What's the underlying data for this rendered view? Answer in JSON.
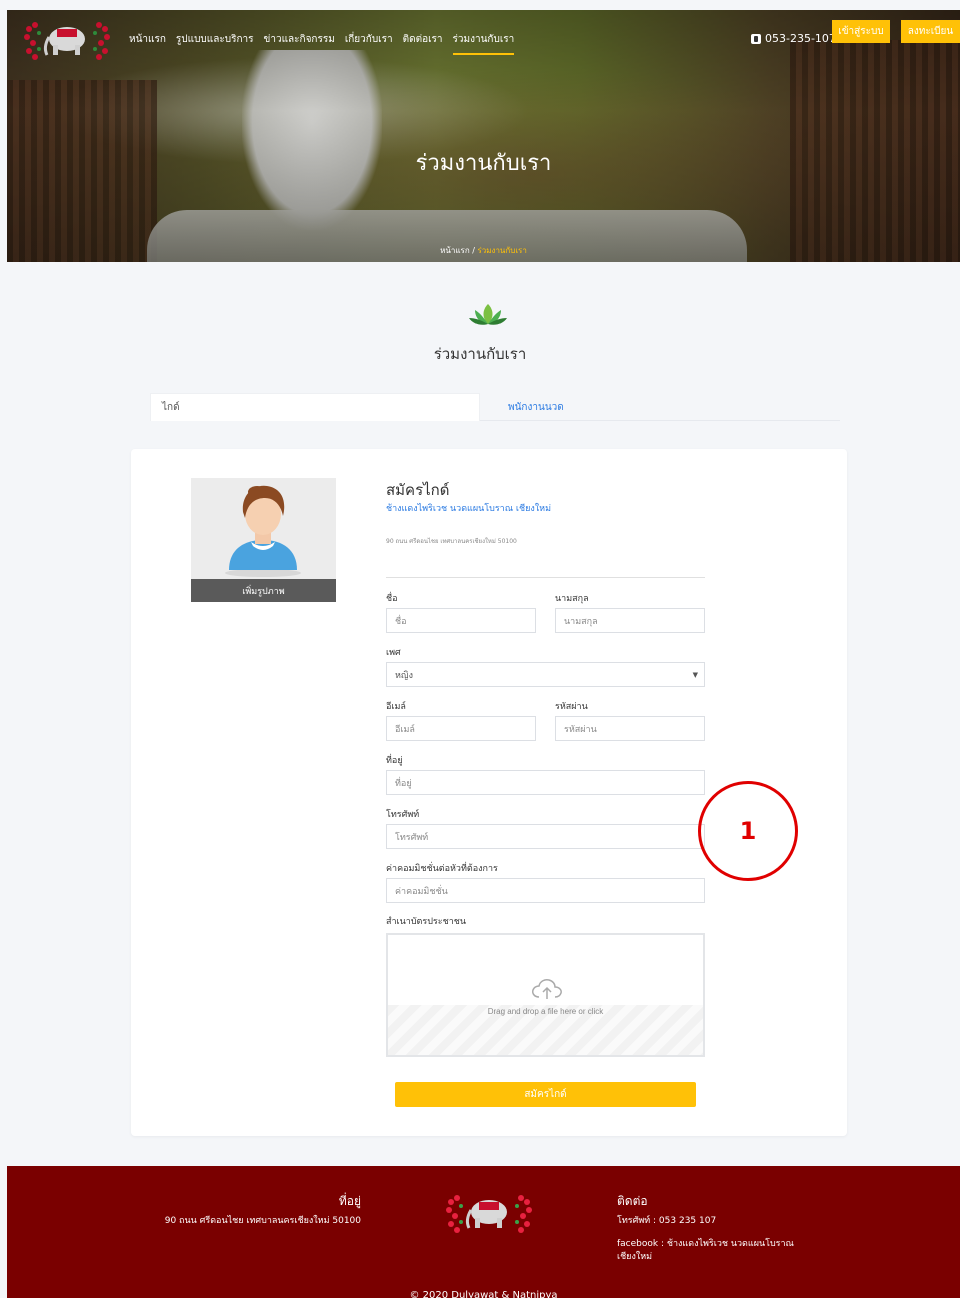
{
  "nav": {
    "menu": [
      "หน้าแรก",
      "รูปแบบและบริการ",
      "ข่าวและกิจกรรม",
      "เกี่ยวกับเรา",
      "ติดต่อเรา",
      "ร่วมงานกับเรา"
    ],
    "phone": "053-235-107",
    "login": "เข้าสู่ระบบ",
    "register": "ลงทะเบียน"
  },
  "hero": {
    "title": "ร่วมงานกับเรา",
    "breadcrumb_home": "หน้าแรก",
    "breadcrumb_sep": " / ",
    "breadcrumb_current": "ร่วมงานกับเรา"
  },
  "section": {
    "title": "ร่วมงานกับเรา"
  },
  "tabs": {
    "guide": "ไกด์",
    "masseuse": "พนักงานนวด"
  },
  "profile": {
    "add_photo": "เพิ่มรูปภาพ"
  },
  "form": {
    "title": "สมัครไกด์",
    "subtitle": "ช้างแดงไพริเวช นวดแผนโบราณ เชียงใหม่",
    "address": "90 ถนน ศรีดอนไชย เทศบาลนครเชียงใหม่ 50100",
    "first_name_label": "ชื่อ",
    "first_name_placeholder": "ชื่อ",
    "last_name_label": "นามสกุล",
    "last_name_placeholder": "นามสกุล",
    "gender_label": "เพศ",
    "gender_value": "หญิง",
    "email_label": "อีเมล์",
    "email_placeholder": "อีเมล์",
    "password_label": "รหัสผ่าน",
    "password_placeholder": "รหัสผ่าน",
    "address_label": "ที่อยู่",
    "address_placeholder": "ที่อยู่",
    "phone_label": "โทรศัพท์",
    "phone_placeholder": "โทรศัพท์",
    "commission_label": "ค่าคอมมิชชั่นต่อหัวที่ต้องการ",
    "commission_placeholder": "ค่าคอมมิชชั่น",
    "idcard_label": "สำเนาบัตรประชาชน",
    "upload_text": "Drag and drop a file here or click",
    "submit": "สมัครไกด์"
  },
  "annotation": {
    "number": "1",
    "color": "#e00000"
  },
  "footer": {
    "address_title": "ที่อยู่",
    "address": "90 ถนน ศรีดอนไชย เทศบาลนครเชียงใหม่ 50100",
    "contact_title": "ติดต่อ",
    "phone": "โทรศัพท์ : 053 235 107",
    "facebook": "facebook : ช้างแดงไพริเวช นวดแผนโบราณ เชียงใหม่",
    "copyright": "© 2020 Dulyawat & Natnipya"
  },
  "colors": {
    "accent": "#ffc107",
    "footer_bg": "#7a0000",
    "link": "#2a7ae2"
  },
  "icons": [
    "elephant-logo-icon",
    "phone-icon",
    "lotus-icon",
    "avatar-icon",
    "cloud-upload-icon",
    "chevron-down-icon"
  ]
}
